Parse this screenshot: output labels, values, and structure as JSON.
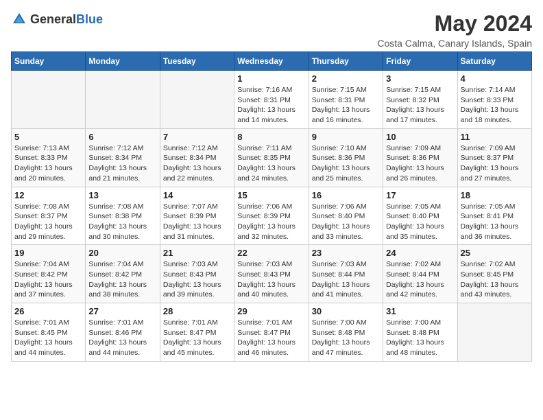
{
  "logo": {
    "text_general": "General",
    "text_blue": "Blue"
  },
  "title": "May 2024",
  "subtitle": "Costa Calma, Canary Islands, Spain",
  "days_of_week": [
    "Sunday",
    "Monday",
    "Tuesday",
    "Wednesday",
    "Thursday",
    "Friday",
    "Saturday"
  ],
  "weeks": [
    [
      {
        "day": "",
        "info": ""
      },
      {
        "day": "",
        "info": ""
      },
      {
        "day": "",
        "info": ""
      },
      {
        "day": "1",
        "info": "Sunrise: 7:16 AM\nSunset: 8:31 PM\nDaylight: 13 hours\nand 14 minutes."
      },
      {
        "day": "2",
        "info": "Sunrise: 7:15 AM\nSunset: 8:31 PM\nDaylight: 13 hours\nand 16 minutes."
      },
      {
        "day": "3",
        "info": "Sunrise: 7:15 AM\nSunset: 8:32 PM\nDaylight: 13 hours\nand 17 minutes."
      },
      {
        "day": "4",
        "info": "Sunrise: 7:14 AM\nSunset: 8:33 PM\nDaylight: 13 hours\nand 18 minutes."
      }
    ],
    [
      {
        "day": "5",
        "info": "Sunrise: 7:13 AM\nSunset: 8:33 PM\nDaylight: 13 hours\nand 20 minutes."
      },
      {
        "day": "6",
        "info": "Sunrise: 7:12 AM\nSunset: 8:34 PM\nDaylight: 13 hours\nand 21 minutes."
      },
      {
        "day": "7",
        "info": "Sunrise: 7:12 AM\nSunset: 8:34 PM\nDaylight: 13 hours\nand 22 minutes."
      },
      {
        "day": "8",
        "info": "Sunrise: 7:11 AM\nSunset: 8:35 PM\nDaylight: 13 hours\nand 24 minutes."
      },
      {
        "day": "9",
        "info": "Sunrise: 7:10 AM\nSunset: 8:36 PM\nDaylight: 13 hours\nand 25 minutes."
      },
      {
        "day": "10",
        "info": "Sunrise: 7:09 AM\nSunset: 8:36 PM\nDaylight: 13 hours\nand 26 minutes."
      },
      {
        "day": "11",
        "info": "Sunrise: 7:09 AM\nSunset: 8:37 PM\nDaylight: 13 hours\nand 27 minutes."
      }
    ],
    [
      {
        "day": "12",
        "info": "Sunrise: 7:08 AM\nSunset: 8:37 PM\nDaylight: 13 hours\nand 29 minutes."
      },
      {
        "day": "13",
        "info": "Sunrise: 7:08 AM\nSunset: 8:38 PM\nDaylight: 13 hours\nand 30 minutes."
      },
      {
        "day": "14",
        "info": "Sunrise: 7:07 AM\nSunset: 8:39 PM\nDaylight: 13 hours\nand 31 minutes."
      },
      {
        "day": "15",
        "info": "Sunrise: 7:06 AM\nSunset: 8:39 PM\nDaylight: 13 hours\nand 32 minutes."
      },
      {
        "day": "16",
        "info": "Sunrise: 7:06 AM\nSunset: 8:40 PM\nDaylight: 13 hours\nand 33 minutes."
      },
      {
        "day": "17",
        "info": "Sunrise: 7:05 AM\nSunset: 8:40 PM\nDaylight: 13 hours\nand 35 minutes."
      },
      {
        "day": "18",
        "info": "Sunrise: 7:05 AM\nSunset: 8:41 PM\nDaylight: 13 hours\nand 36 minutes."
      }
    ],
    [
      {
        "day": "19",
        "info": "Sunrise: 7:04 AM\nSunset: 8:42 PM\nDaylight: 13 hours\nand 37 minutes."
      },
      {
        "day": "20",
        "info": "Sunrise: 7:04 AM\nSunset: 8:42 PM\nDaylight: 13 hours\nand 38 minutes."
      },
      {
        "day": "21",
        "info": "Sunrise: 7:03 AM\nSunset: 8:43 PM\nDaylight: 13 hours\nand 39 minutes."
      },
      {
        "day": "22",
        "info": "Sunrise: 7:03 AM\nSunset: 8:43 PM\nDaylight: 13 hours\nand 40 minutes."
      },
      {
        "day": "23",
        "info": "Sunrise: 7:03 AM\nSunset: 8:44 PM\nDaylight: 13 hours\nand 41 minutes."
      },
      {
        "day": "24",
        "info": "Sunrise: 7:02 AM\nSunset: 8:44 PM\nDaylight: 13 hours\nand 42 minutes."
      },
      {
        "day": "25",
        "info": "Sunrise: 7:02 AM\nSunset: 8:45 PM\nDaylight: 13 hours\nand 43 minutes."
      }
    ],
    [
      {
        "day": "26",
        "info": "Sunrise: 7:01 AM\nSunset: 8:45 PM\nDaylight: 13 hours\nand 44 minutes."
      },
      {
        "day": "27",
        "info": "Sunrise: 7:01 AM\nSunset: 8:46 PM\nDaylight: 13 hours\nand 44 minutes."
      },
      {
        "day": "28",
        "info": "Sunrise: 7:01 AM\nSunset: 8:47 PM\nDaylight: 13 hours\nand 45 minutes."
      },
      {
        "day": "29",
        "info": "Sunrise: 7:01 AM\nSunset: 8:47 PM\nDaylight: 13 hours\nand 46 minutes."
      },
      {
        "day": "30",
        "info": "Sunrise: 7:00 AM\nSunset: 8:48 PM\nDaylight: 13 hours\nand 47 minutes."
      },
      {
        "day": "31",
        "info": "Sunrise: 7:00 AM\nSunset: 8:48 PM\nDaylight: 13 hours\nand 48 minutes."
      },
      {
        "day": "",
        "info": ""
      }
    ]
  ]
}
